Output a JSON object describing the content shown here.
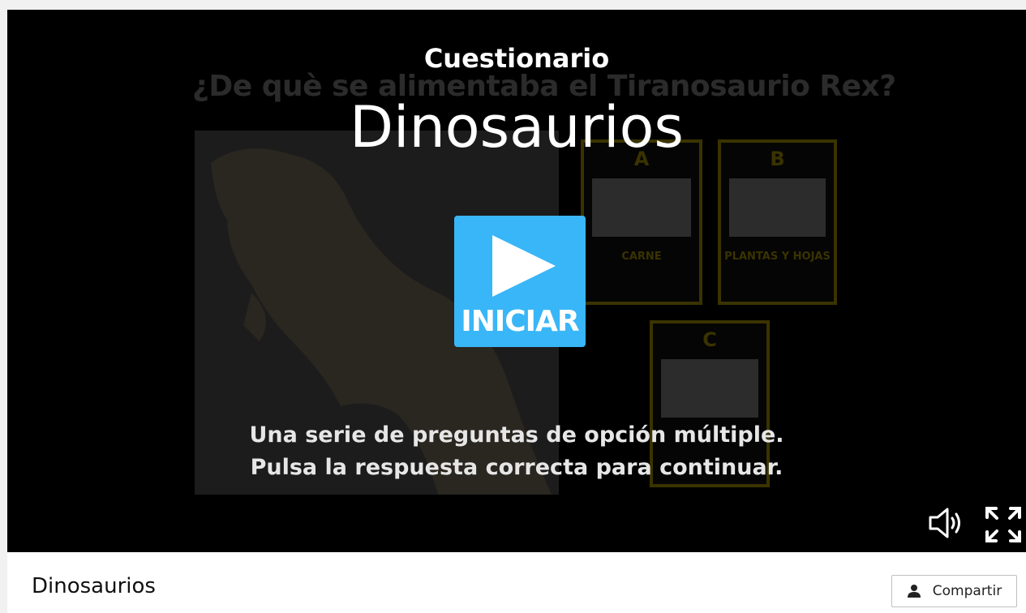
{
  "background_slide": {
    "question": "¿De què se alimentaba el Tiranosaurio Rex?",
    "answers": [
      {
        "letter": "A",
        "caption": "CARNE"
      },
      {
        "letter": "B",
        "caption": "PLANTAS Y HOJAS"
      },
      {
        "letter": "C",
        "caption": ""
      }
    ]
  },
  "overlay": {
    "kicker": "Cuestionario",
    "title": "Dinosaurios",
    "start_label": "INICIAR",
    "description_line1": "Una serie de preguntas de opción múltiple.",
    "description_line2": "Pulsa la respuesta correcta para continuar."
  },
  "controls": {
    "volume_icon": "volume-icon",
    "fullscreen_icon": "fullscreen-icon"
  },
  "footer": {
    "title": "Dinosaurios",
    "share_label": "Compartir"
  },
  "colors": {
    "accent": "#39b6f7",
    "stage_bg": "#000000"
  }
}
